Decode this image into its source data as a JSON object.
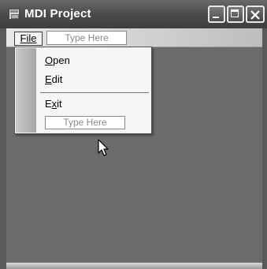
{
  "window": {
    "title": "MDI Project"
  },
  "menubar": {
    "file_label": "File",
    "type_here": "Type Here"
  },
  "file_menu": {
    "items": [
      {
        "label": "Open",
        "mnemonic_index": 0
      },
      {
        "label": "Edit",
        "mnemonic_index": 0
      },
      {
        "label": "Exit",
        "mnemonic_index": 1
      }
    ],
    "type_here": "Type Here"
  },
  "icons": {
    "app": "app-icon",
    "minimize": "minimize-icon",
    "maximize": "maximize-icon",
    "close": "close-icon",
    "cursor": "mouse-pointer-icon"
  },
  "colors": {
    "title_bar": "#4d4d4d",
    "mdi_background": "#6b6b6b",
    "menu_background": "#f5f5f5"
  }
}
